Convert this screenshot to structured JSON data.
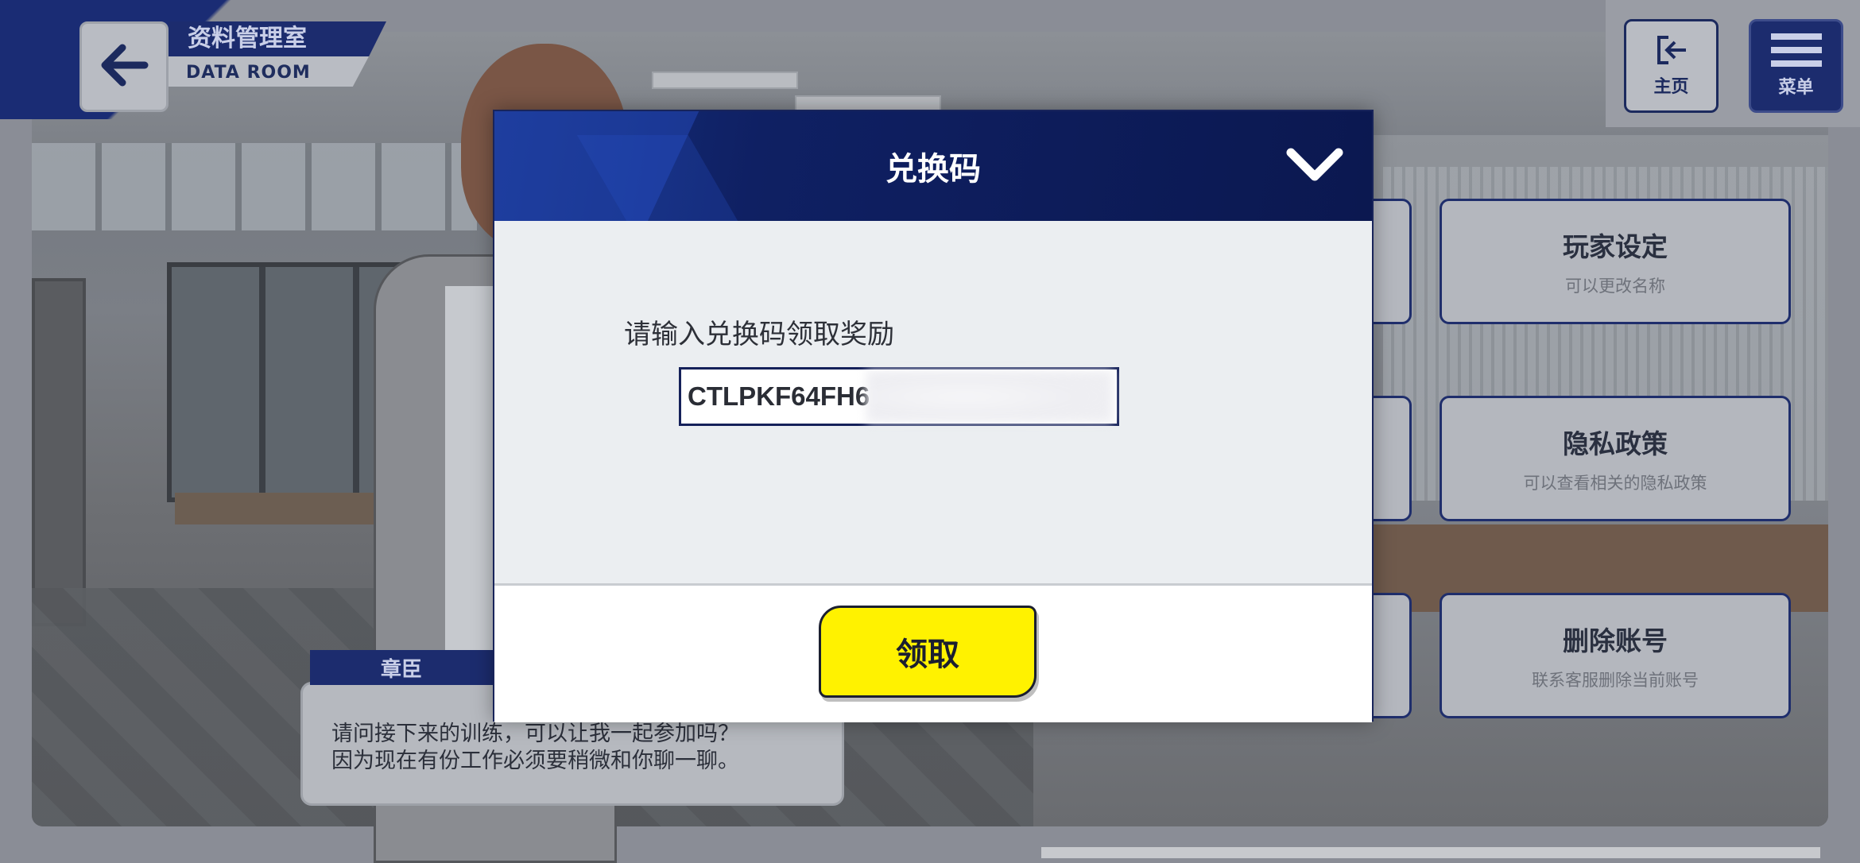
{
  "header": {
    "title_cn": "资料管理室",
    "title_en": "DATA ROOM"
  },
  "top_right": {
    "home_label": "主页",
    "menu_label": "菜单"
  },
  "settings_cards": [
    {
      "title": "玩家设定",
      "subtitle": "可以更改名称"
    },
    {
      "title": "隐私政策",
      "subtitle": "可以查看相关的隐私政策"
    },
    {
      "title": "删除账号",
      "subtitle": "联系客服删除当前账号"
    }
  ],
  "dialogue": {
    "speaker": "章臣",
    "text": "请问接下来的训练，可以让我一起参加吗？\n因为现在有份工作必须要稍微和你聊一聊。"
  },
  "modal": {
    "title": "兑换码",
    "prompt": "请输入兑换码领取奖励",
    "code_value": "CTLPKF64FH6",
    "claim_label": "领取"
  },
  "icons": {
    "back": "arrow-left-icon",
    "home": "exit-icon",
    "menu": "hamburger-icon",
    "close": "chevron-down-icon"
  },
  "colors": {
    "navy": "#1c2c6e",
    "claim_button": "#fff200",
    "card_border": "#1f2e6c"
  }
}
